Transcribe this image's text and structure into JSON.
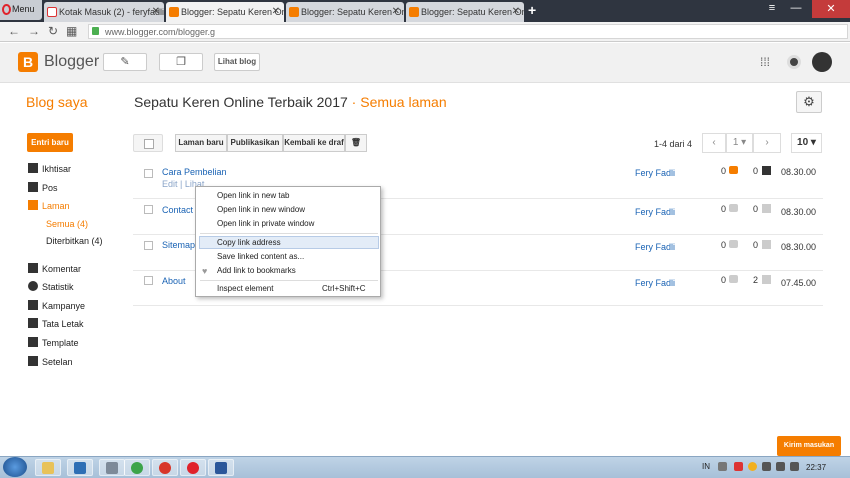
{
  "browser": {
    "menu_label": "Menu",
    "tabs": [
      {
        "label": "Kotak Masuk (2) - feryfadli"
      },
      {
        "label": "Blogger: Sepatu Keren Onl"
      },
      {
        "label": "Blogger: Sepatu Keren Onl"
      },
      {
        "label": "Blogger: Sepatu Keren Onl"
      }
    ],
    "close_glyph": "✕",
    "newtab_glyph": "+",
    "url": "www.blogger.com/blogger.g"
  },
  "header": {
    "app_name": "Blogger",
    "view_blog": "Lihat blog"
  },
  "page": {
    "sidebar_title": "Blog saya",
    "blog_title": "Sepatu Keren Online Terbaik 2017",
    "separator": "·",
    "subtitle": "Semua laman"
  },
  "sidebar": {
    "new_button": "Entri baru",
    "items": [
      {
        "label": "Ikhtisar"
      },
      {
        "label": "Pos"
      },
      {
        "label": "Laman"
      },
      {
        "label": "Komentar"
      },
      {
        "label": "Statistik"
      },
      {
        "label": "Kampanye"
      },
      {
        "label": "Tata Letak"
      },
      {
        "label": "Template"
      },
      {
        "label": "Setelan"
      }
    ],
    "subitems": [
      {
        "label": "Semua (4)"
      },
      {
        "label": "Diterbitkan (4)"
      }
    ]
  },
  "toolbar": {
    "new_page": "Laman baru",
    "publish": "Publikasikan",
    "revert": "Kembali ke draf",
    "pager": "1-4 dari 4",
    "page_select": "1",
    "per_page": "10"
  },
  "pages": [
    {
      "title": "Cara Pembelian",
      "actions": "Edit | Lihat",
      "author": "Fery Fadli",
      "comments": "0",
      "views": "0",
      "time": "08.30.00"
    },
    {
      "title": "Contact",
      "actions": "",
      "author": "Fery Fadli",
      "comments": "0",
      "views": "0",
      "time": "08.30.00"
    },
    {
      "title": "Sitemap",
      "actions": "",
      "author": "Fery Fadli",
      "comments": "0",
      "views": "0",
      "time": "08.30.00"
    },
    {
      "title": "About",
      "actions": "",
      "author": "Fery Fadli",
      "comments": "0",
      "views": "2",
      "time": "07.45.00"
    }
  ],
  "context_menu": {
    "items": [
      {
        "label": "Open link in new tab"
      },
      {
        "label": "Open link in new window"
      },
      {
        "label": "Open link in private window"
      },
      {
        "label": "Copy link address"
      },
      {
        "label": "Save linked content as..."
      },
      {
        "label": "Add link to bookmarks"
      },
      {
        "label": "Inspect element",
        "shortcut": "Ctrl+Shift+C"
      }
    ]
  },
  "feedback_button": "Kirim masukan",
  "taskbar": {
    "lang": "IN",
    "clock": "22:37"
  },
  "colors": {
    "accent": "#f57d00",
    "link": "#1a63b4"
  }
}
